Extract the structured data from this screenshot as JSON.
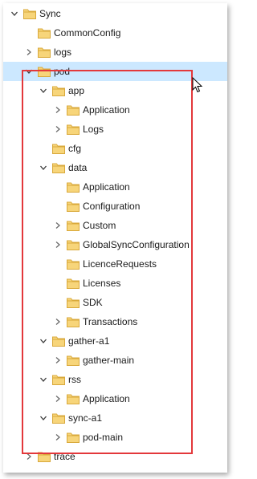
{
  "tree": [
    {
      "label": "Sync",
      "level": 0,
      "expander": "expanded"
    },
    {
      "label": "CommonConfig",
      "level": 1,
      "expander": "none"
    },
    {
      "label": "logs",
      "level": 1,
      "expander": "collapsed"
    },
    {
      "label": "pod",
      "level": 1,
      "expander": "expanded",
      "selected": true
    },
    {
      "label": "app",
      "level": 2,
      "expander": "expanded"
    },
    {
      "label": "Application",
      "level": 3,
      "expander": "collapsed"
    },
    {
      "label": "Logs",
      "level": 3,
      "expander": "collapsed"
    },
    {
      "label": "cfg",
      "level": 2,
      "expander": "none"
    },
    {
      "label": "data",
      "level": 2,
      "expander": "expanded"
    },
    {
      "label": "Application",
      "level": 3,
      "expander": "none"
    },
    {
      "label": "Configuration",
      "level": 3,
      "expander": "none"
    },
    {
      "label": "Custom",
      "level": 3,
      "expander": "collapsed"
    },
    {
      "label": "GlobalSyncConfiguration",
      "level": 3,
      "expander": "collapsed"
    },
    {
      "label": "LicenceRequests",
      "level": 3,
      "expander": "none"
    },
    {
      "label": "Licenses",
      "level": 3,
      "expander": "none"
    },
    {
      "label": "SDK",
      "level": 3,
      "expander": "none"
    },
    {
      "label": "Transactions",
      "level": 3,
      "expander": "collapsed"
    },
    {
      "label": "gather-a1",
      "level": 2,
      "expander": "expanded"
    },
    {
      "label": "gather-main",
      "level": 3,
      "expander": "collapsed"
    },
    {
      "label": "rss",
      "level": 2,
      "expander": "expanded"
    },
    {
      "label": "Application",
      "level": 3,
      "expander": "collapsed"
    },
    {
      "label": "sync-a1",
      "level": 2,
      "expander": "expanded"
    },
    {
      "label": "pod-main",
      "level": 3,
      "expander": "collapsed"
    },
    {
      "label": "trace",
      "level": 1,
      "expander": "collapsed"
    }
  ],
  "colors": {
    "folder_fill": "#f7d57a",
    "folder_edge": "#d9a93b",
    "selection": "#cce8ff",
    "highlight_border": "#e3383b"
  }
}
